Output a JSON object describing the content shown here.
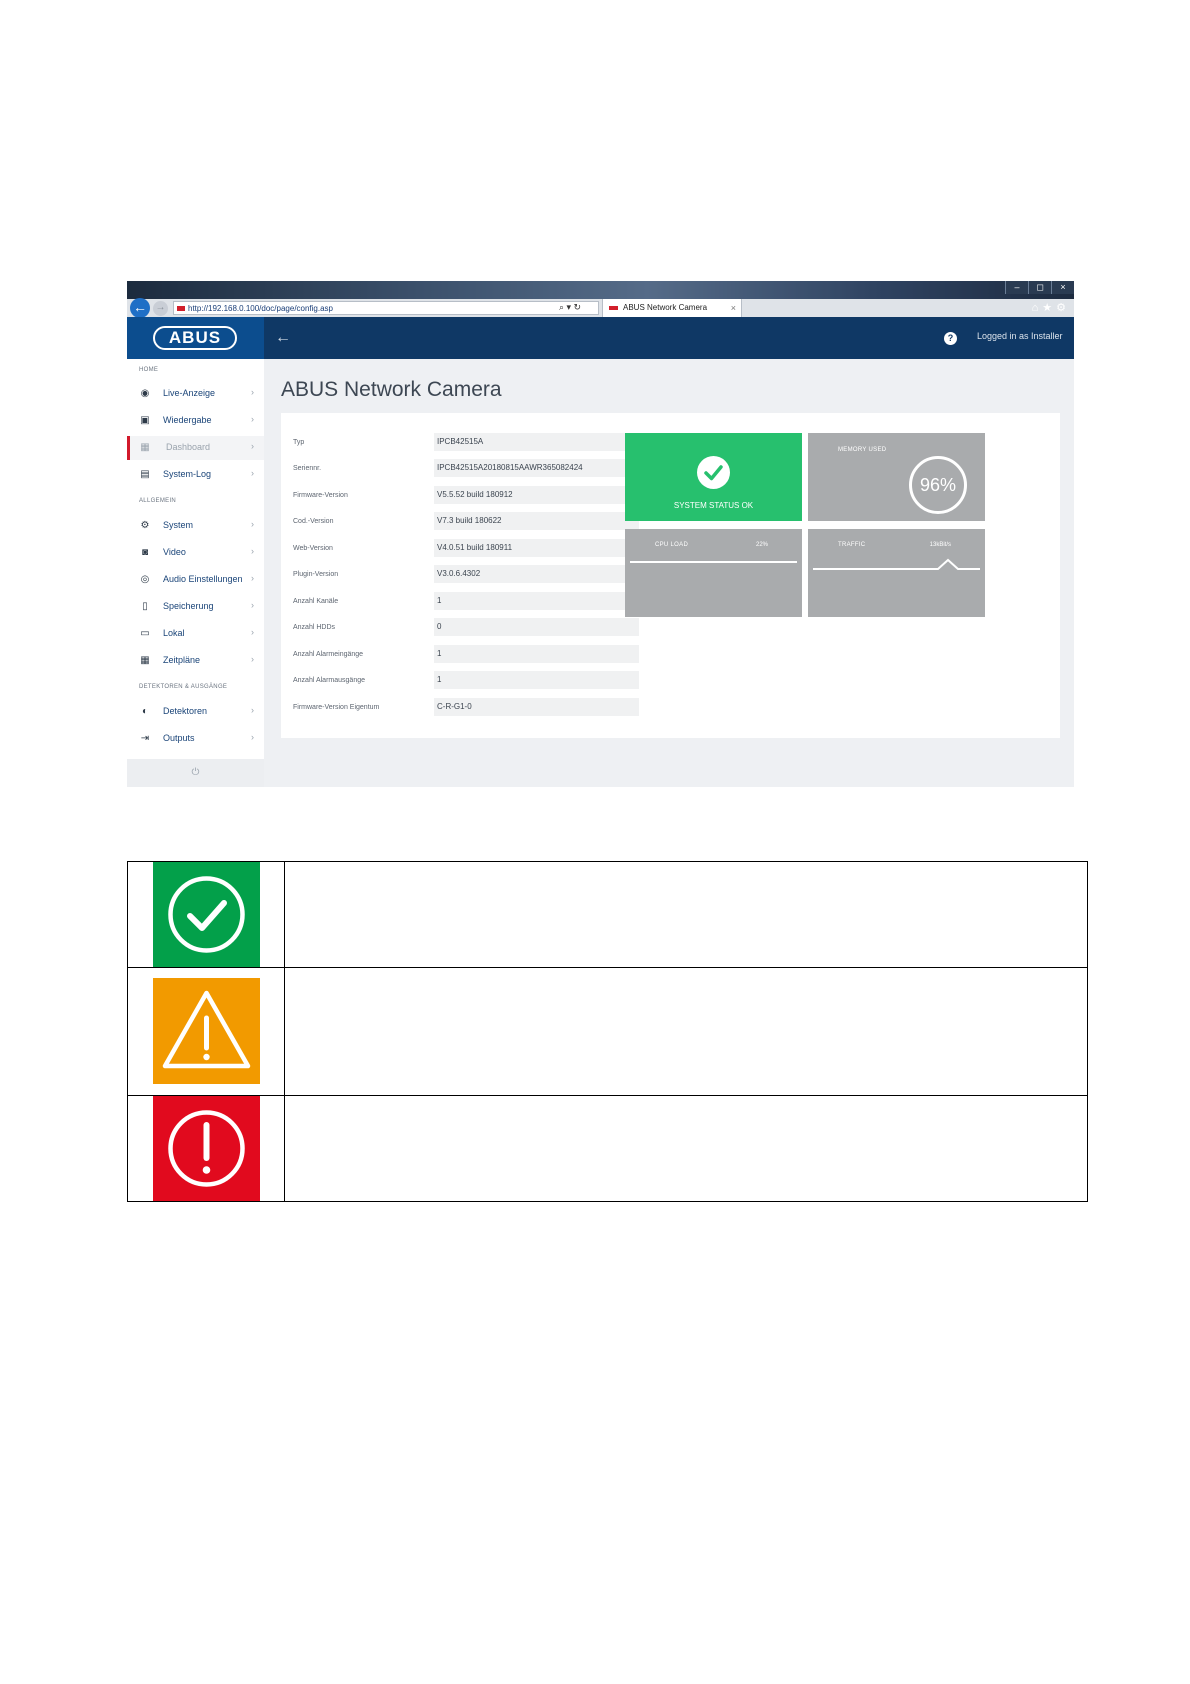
{
  "browser": {
    "url": "http://192.168.0.100/doc/page/config.asp",
    "tab_title": "ABUS Network Camera",
    "tab_close": "×",
    "win_buttons": [
      "–",
      "◻",
      "×"
    ],
    "addr_tools": "⌕ ▾ ↻",
    "nav_tools": "⌂★⚙"
  },
  "header": {
    "logo": "ABUS",
    "back_arrow": "←",
    "help": "?",
    "login": "Logged in as Installer"
  },
  "sidebar": {
    "sections": [
      "HOME",
      "ALLGEMEIN",
      "DETEKTOREN & AUSGÄNGE"
    ],
    "items": [
      {
        "label": "Live-Anzeige",
        "icon": "eye-icon"
      },
      {
        "label": "Wiedergabe",
        "icon": "playback-icon"
      },
      {
        "label": "Dashboard",
        "icon": "dashboard-icon"
      },
      {
        "label": "System-Log",
        "icon": "log-icon"
      },
      {
        "label": "System",
        "icon": "gear-icon"
      },
      {
        "label": "Video",
        "icon": "video-icon"
      },
      {
        "label": "Audio Einstellungen",
        "icon": "audio-icon"
      },
      {
        "label": "Speicherung",
        "icon": "storage-icon"
      },
      {
        "label": "Lokal",
        "icon": "local-icon"
      },
      {
        "label": "Zeitpläne",
        "icon": "calendar-icon"
      },
      {
        "label": "Detektoren",
        "icon": "detector-icon"
      },
      {
        "label": "Outputs",
        "icon": "output-icon"
      }
    ],
    "chevron": "›",
    "power": "⏻"
  },
  "main": {
    "title": "ABUS Network Camera",
    "info": [
      {
        "key": "Typ",
        "value": "IPCB42515A"
      },
      {
        "key": "Seriennr.",
        "value": "IPCB42515A20180815AAWR365082424"
      },
      {
        "key": "Firmware-Version",
        "value": "V5.5.52 build 180912"
      },
      {
        "key": "Cod.-Version",
        "value": "V7.3 build 180622"
      },
      {
        "key": "Web-Version",
        "value": "V4.0.51 build 180911"
      },
      {
        "key": "Plugin-Version",
        "value": "V3.0.6.4302"
      },
      {
        "key": "Anzahl Kanäle",
        "value": "1"
      },
      {
        "key": "Anzahl HDDs",
        "value": "0"
      },
      {
        "key": "Anzahl Alarmeingänge",
        "value": "1"
      },
      {
        "key": "Anzahl Alarmausgänge",
        "value": "1"
      },
      {
        "key": "Firmware-Version Eigentum",
        "value": "C-R-G1-0"
      }
    ],
    "tiles": {
      "status_label": "SYSTEM STATUS OK",
      "memory_label": "MEMORY USED",
      "memory_value": "96%",
      "cpu_label": "CPU LOAD",
      "cpu_value": "22%",
      "traffic_label": "TRAFFIC",
      "traffic_value": "13kBit/s"
    },
    "colors": {
      "status_ok": "#27c06e",
      "tile_gray": "#a9abad",
      "header": "#0f3865",
      "accent_red": "#d2192b"
    }
  },
  "legend": {
    "rows": [
      {
        "icon": "check-circle-icon",
        "color": "#03a04a",
        "text": ""
      },
      {
        "icon": "warning-triangle-icon",
        "color": "#f29a00",
        "text": ""
      },
      {
        "icon": "error-exclamation-icon",
        "color": "#e10a1e",
        "text": ""
      }
    ]
  }
}
